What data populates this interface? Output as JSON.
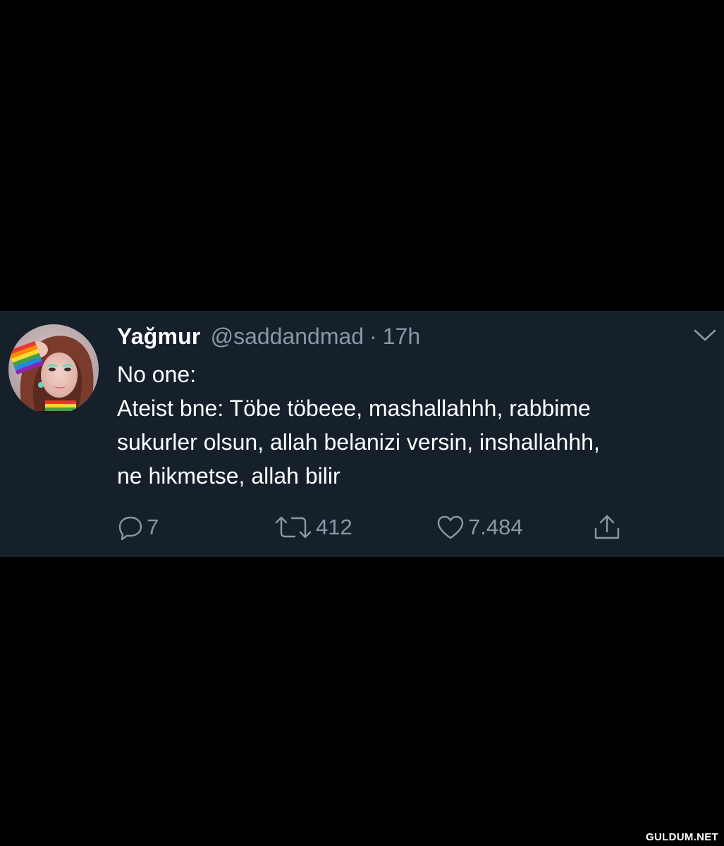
{
  "colors": {
    "page_background": "#000000",
    "card_background": "#15202b",
    "text_primary": "#ffffff",
    "text_secondary": "#8899a6"
  },
  "tweet": {
    "display_name": "Yağmur",
    "handle": "@saddandmad",
    "separator": "·",
    "timestamp": "17h",
    "body_lines": [
      "No one:",
      "Ateist bne: Töbe töbeee, mashallahhh, rabbime",
      "sukurler olsun, allah belanizi versin, inshallahhh,",
      "ne hikmetse, allah bilir"
    ],
    "icons": {
      "avatar": "avatar",
      "menu": "chevron-down-icon",
      "reply": "reply-icon",
      "retweet": "retweet-icon",
      "like": "heart-icon",
      "share": "share-icon"
    },
    "actions": {
      "replies": "7",
      "retweets": "412",
      "likes": "7.484"
    }
  },
  "watermark": "GULDUM.NET"
}
